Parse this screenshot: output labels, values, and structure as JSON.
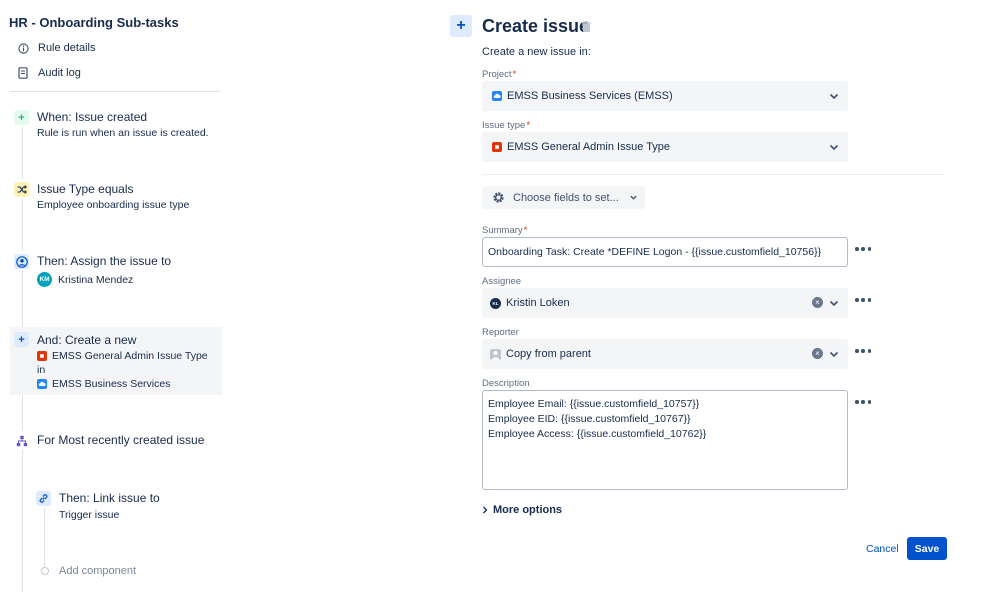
{
  "rule": {
    "title": "HR - Onboarding Sub-tasks",
    "nav": [
      {
        "label": "Rule details",
        "icon": "info-icon"
      },
      {
        "label": "Audit log",
        "icon": "document-icon"
      }
    ]
  },
  "components": {
    "trigger": {
      "title": "When: Issue created",
      "subtitle": "Rule is run when an issue is created.",
      "icon": "plus-icon",
      "color": "#36b37e"
    },
    "condition": {
      "title": "Issue Type equals",
      "subtitle": "Employee onboarding issue type",
      "icon": "shuffle-icon",
      "color": "#ffab00"
    },
    "assign": {
      "title": "Then: Assign the issue to",
      "user_initials": "KM",
      "user_name": "Kristina Mendez",
      "icon": "user-circle-icon",
      "color": "#0052cc"
    },
    "create": {
      "title": "And: Create a new",
      "issue_type": "EMSS General Admin Issue Type",
      "connector": "in",
      "project": "EMSS Business Services",
      "icon": "plus-icon",
      "color": "#0052cc"
    },
    "branch": {
      "title": "For Most recently created issue",
      "icon": "branch-icon",
      "color": "#6554c0"
    },
    "link": {
      "title": "Then: Link issue to",
      "subtitle": "Trigger issue",
      "icon": "link-icon",
      "color": "#0052cc"
    },
    "add_label": "Add component"
  },
  "form": {
    "title": "Create issue",
    "intro": "Create a new issue in:",
    "project": {
      "label": "Project",
      "value": "EMSS Business Services (EMSS)"
    },
    "issue_type": {
      "label": "Issue type",
      "value": "EMSS General Admin Issue Type"
    },
    "choose_fields": "Choose fields to set...",
    "summary": {
      "label": "Summary",
      "value": "Onboarding Task: Create *DEFINE Logon -  {{issue.customfield_10756}}"
    },
    "assignee": {
      "label": "Assignee",
      "initials": "KL",
      "value": "Kristin Loken"
    },
    "reporter": {
      "label": "Reporter",
      "value": "Copy from parent"
    },
    "description": {
      "label": "Description",
      "lines": [
        "Employee Email: {{issue.customfield_10757}}",
        "Employee EID: {{issue.customfield_10767}}",
        "Employee Access: {{issue.customfield_10762}}"
      ]
    },
    "more_options": "More options",
    "cancel": "Cancel",
    "save": "Save",
    "required_mark": "*"
  },
  "colors": {
    "brand_blue": "#0052cc",
    "issue_red": "#de350b",
    "project_blue": "#2684ff"
  }
}
